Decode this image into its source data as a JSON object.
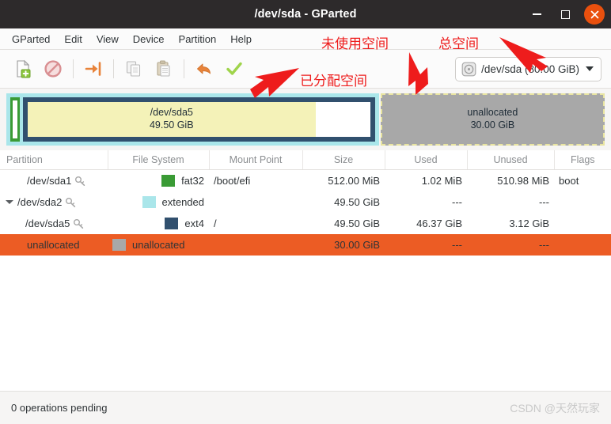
{
  "window": {
    "title": "/dev/sda - GParted",
    "controls": {
      "minimize": "–",
      "maximize": "□",
      "close": "✕"
    }
  },
  "menubar": {
    "items": [
      {
        "label": "GParted"
      },
      {
        "label": "Edit"
      },
      {
        "label": "View"
      },
      {
        "label": "Device"
      },
      {
        "label": "Partition"
      },
      {
        "label": "Help"
      }
    ]
  },
  "toolbar": {
    "buttons": [
      {
        "name": "new-partition-icon",
        "title": "New"
      },
      {
        "name": "delete-partition-icon",
        "title": "Delete"
      },
      {
        "name": "resize-move-icon",
        "title": "Resize/Move"
      },
      {
        "name": "copy-icon",
        "title": "Copy"
      },
      {
        "name": "paste-icon",
        "title": "Paste"
      },
      {
        "name": "undo-icon",
        "title": "Undo"
      },
      {
        "name": "apply-icon",
        "title": "Apply"
      }
    ],
    "device_selector": {
      "label": "/dev/sda (80.00 GiB)",
      "icon": "disk-icon"
    }
  },
  "graphic": {
    "sda1": {
      "label": "",
      "color": "#3a9b35"
    },
    "sda5": {
      "name": "/dev/sda5",
      "size": "49.50 GiB",
      "fill": "#f4f2b8",
      "border": "#31506e"
    },
    "extended": {
      "color": "#aae6ea"
    },
    "unallocated": {
      "name": "unallocated",
      "size": "30.00 GiB",
      "fill": "#a8a8a8",
      "border": "#e8e4a0"
    }
  },
  "table": {
    "headers": [
      "Partition",
      "File System",
      "Mount Point",
      "Size",
      "Used",
      "Unused",
      "Flags"
    ],
    "rows": [
      {
        "partition": "/dev/sda1",
        "filesystem": "fat32",
        "mountpoint": "/boot/efi",
        "size": "512.00 MiB",
        "used": "1.02 MiB",
        "unused": "510.98 MiB",
        "flags": "boot",
        "swatch": "#3a9b35",
        "indent": 1,
        "expander": false,
        "key": true,
        "selected": false
      },
      {
        "partition": "/dev/sda2",
        "filesystem": "extended",
        "mountpoint": "",
        "size": "49.50 GiB",
        "used": "---",
        "unused": "---",
        "flags": "",
        "swatch": "#aae6ea",
        "indent": 1,
        "expander": true,
        "key": true,
        "selected": false
      },
      {
        "partition": "/dev/sda5",
        "filesystem": "ext4",
        "mountpoint": "/",
        "size": "49.50 GiB",
        "used": "46.37 GiB",
        "unused": "3.12 GiB",
        "flags": "",
        "swatch": "#31506e",
        "indent": 2,
        "expander": false,
        "key": true,
        "selected": false
      },
      {
        "partition": "unallocated",
        "filesystem": "unallocated",
        "mountpoint": "",
        "size": "30.00 GiB",
        "used": "---",
        "unused": "---",
        "flags": "",
        "swatch": "#a8a8a8",
        "indent": 1,
        "expander": false,
        "key": false,
        "selected": true
      }
    ]
  },
  "statusbar": {
    "text": "0 operations pending",
    "watermark": "CSDN @天然玩家"
  },
  "annotations": {
    "unused_space": "未使用空间",
    "total_space": "总空间",
    "allocated_space": "已分配空间",
    "color": "#ee1c1c"
  }
}
